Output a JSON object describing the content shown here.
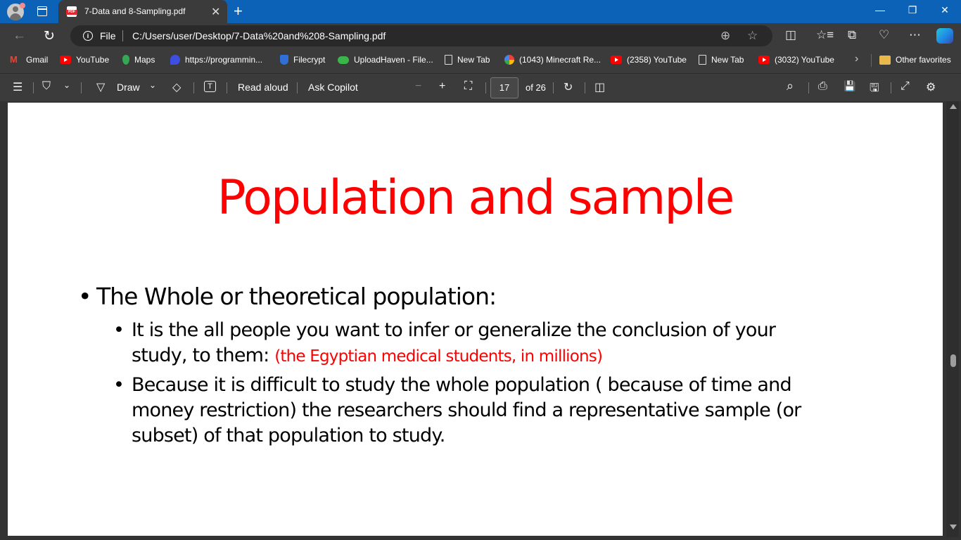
{
  "browser": {
    "tab": {
      "title": "7-Data and 8-Sampling.pdf",
      "icon": "pdf-icon",
      "icon_label": "PDF"
    },
    "new_tab_label": "+",
    "window_controls": {
      "minimize": "—",
      "restore": "❐",
      "close": "✕"
    },
    "address": {
      "scheme_label": "File",
      "url": "C:/Users/user/Desktop/7-Data%20and%208-Sampling.pdf"
    },
    "icons": {
      "back": "←",
      "refresh": "↻",
      "zoom": "⊕",
      "favorite": "☆",
      "split": "◫",
      "favorites": "☆≡",
      "collections": "⧉",
      "health": "♡",
      "more": "⋯"
    }
  },
  "bookmarks": [
    {
      "label": "Gmail",
      "icon": "gmail-icon"
    },
    {
      "label": "YouTube",
      "icon": "youtube-icon"
    },
    {
      "label": "Maps",
      "icon": "maps-icon"
    },
    {
      "label": "https://programmin...",
      "icon": "programming-site-icon"
    },
    {
      "label": "Filecrypt",
      "icon": "shield-icon"
    },
    {
      "label": "UploadHaven - File...",
      "icon": "cloud-icon"
    },
    {
      "label": "New Tab",
      "icon": "page-icon"
    },
    {
      "label": "(1043) Minecraft Re...",
      "icon": "google-icon"
    },
    {
      "label": "(2358) YouTube",
      "icon": "youtube-icon"
    },
    {
      "label": "New Tab",
      "icon": "page-icon"
    },
    {
      "label": "(3032) YouTube",
      "icon": "youtube-icon"
    }
  ],
  "bookmarks_overflow": "›",
  "other_favorites": "Other favorites",
  "pdf_toolbar": {
    "contents_icon": "☰",
    "highlight_icon": "⛉",
    "dropdown": "⌄",
    "draw_icon": "▽",
    "draw_label": "Draw",
    "erase_icon": "◇",
    "text_icon": "T",
    "read_aloud": "Read aloud",
    "ask_copilot": "Ask Copilot",
    "zoom_out": "−",
    "zoom_in": "+",
    "fit_icon": "⛶",
    "current_page": "17",
    "page_count": "of 26",
    "rotate_icon": "↻",
    "page_view_icon": "◫",
    "search_icon": "⌕",
    "print_icon": "⎙",
    "save_icon": "💾",
    "save_as_icon": "🖫",
    "fullscreen_icon": "⤢",
    "settings_icon": "⚙"
  },
  "slide": {
    "title": "Population and sample",
    "heading_bullet": "The Whole or theoretical population:",
    "sub_bullets": [
      {
        "text_line1": "It is the all people you want to infer or generalize  the conclusion of your",
        "text_line2": "study, to them: ",
        "note": "(the Egyptian medical students, in millions)"
      },
      {
        "text": "Because it is difficult to study the whole population ( because of time and money restriction) the researchers should find a representative sample (or subset) of that population to study."
      }
    ],
    "colors": {
      "title": "#ff0000",
      "note": "#ff0000",
      "body": "#000000"
    }
  },
  "scrollbar": {
    "position_fraction": 0.62
  }
}
